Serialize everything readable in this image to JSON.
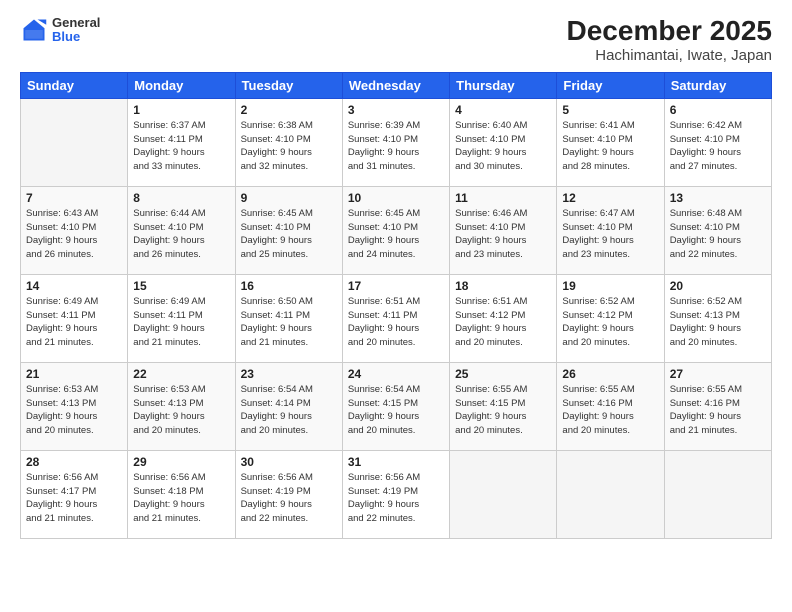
{
  "header": {
    "logo": {
      "general": "General",
      "blue": "Blue"
    },
    "title": "December 2025",
    "subtitle": "Hachimantai, Iwate, Japan"
  },
  "calendar": {
    "weekdays": [
      "Sunday",
      "Monday",
      "Tuesday",
      "Wednesday",
      "Thursday",
      "Friday",
      "Saturday"
    ],
    "weeks": [
      [
        {
          "day": "",
          "info": ""
        },
        {
          "day": "1",
          "info": "Sunrise: 6:37 AM\nSunset: 4:11 PM\nDaylight: 9 hours\nand 33 minutes."
        },
        {
          "day": "2",
          "info": "Sunrise: 6:38 AM\nSunset: 4:10 PM\nDaylight: 9 hours\nand 32 minutes."
        },
        {
          "day": "3",
          "info": "Sunrise: 6:39 AM\nSunset: 4:10 PM\nDaylight: 9 hours\nand 31 minutes."
        },
        {
          "day": "4",
          "info": "Sunrise: 6:40 AM\nSunset: 4:10 PM\nDaylight: 9 hours\nand 30 minutes."
        },
        {
          "day": "5",
          "info": "Sunrise: 6:41 AM\nSunset: 4:10 PM\nDaylight: 9 hours\nand 28 minutes."
        },
        {
          "day": "6",
          "info": "Sunrise: 6:42 AM\nSunset: 4:10 PM\nDaylight: 9 hours\nand 27 minutes."
        }
      ],
      [
        {
          "day": "7",
          "info": "Sunrise: 6:43 AM\nSunset: 4:10 PM\nDaylight: 9 hours\nand 26 minutes."
        },
        {
          "day": "8",
          "info": "Sunrise: 6:44 AM\nSunset: 4:10 PM\nDaylight: 9 hours\nand 26 minutes."
        },
        {
          "day": "9",
          "info": "Sunrise: 6:45 AM\nSunset: 4:10 PM\nDaylight: 9 hours\nand 25 minutes."
        },
        {
          "day": "10",
          "info": "Sunrise: 6:45 AM\nSunset: 4:10 PM\nDaylight: 9 hours\nand 24 minutes."
        },
        {
          "day": "11",
          "info": "Sunrise: 6:46 AM\nSunset: 4:10 PM\nDaylight: 9 hours\nand 23 minutes."
        },
        {
          "day": "12",
          "info": "Sunrise: 6:47 AM\nSunset: 4:10 PM\nDaylight: 9 hours\nand 23 minutes."
        },
        {
          "day": "13",
          "info": "Sunrise: 6:48 AM\nSunset: 4:10 PM\nDaylight: 9 hours\nand 22 minutes."
        }
      ],
      [
        {
          "day": "14",
          "info": "Sunrise: 6:49 AM\nSunset: 4:11 PM\nDaylight: 9 hours\nand 21 minutes."
        },
        {
          "day": "15",
          "info": "Sunrise: 6:49 AM\nSunset: 4:11 PM\nDaylight: 9 hours\nand 21 minutes."
        },
        {
          "day": "16",
          "info": "Sunrise: 6:50 AM\nSunset: 4:11 PM\nDaylight: 9 hours\nand 21 minutes."
        },
        {
          "day": "17",
          "info": "Sunrise: 6:51 AM\nSunset: 4:11 PM\nDaylight: 9 hours\nand 20 minutes."
        },
        {
          "day": "18",
          "info": "Sunrise: 6:51 AM\nSunset: 4:12 PM\nDaylight: 9 hours\nand 20 minutes."
        },
        {
          "day": "19",
          "info": "Sunrise: 6:52 AM\nSunset: 4:12 PM\nDaylight: 9 hours\nand 20 minutes."
        },
        {
          "day": "20",
          "info": "Sunrise: 6:52 AM\nSunset: 4:13 PM\nDaylight: 9 hours\nand 20 minutes."
        }
      ],
      [
        {
          "day": "21",
          "info": "Sunrise: 6:53 AM\nSunset: 4:13 PM\nDaylight: 9 hours\nand 20 minutes."
        },
        {
          "day": "22",
          "info": "Sunrise: 6:53 AM\nSunset: 4:13 PM\nDaylight: 9 hours\nand 20 minutes."
        },
        {
          "day": "23",
          "info": "Sunrise: 6:54 AM\nSunset: 4:14 PM\nDaylight: 9 hours\nand 20 minutes."
        },
        {
          "day": "24",
          "info": "Sunrise: 6:54 AM\nSunset: 4:15 PM\nDaylight: 9 hours\nand 20 minutes."
        },
        {
          "day": "25",
          "info": "Sunrise: 6:55 AM\nSunset: 4:15 PM\nDaylight: 9 hours\nand 20 minutes."
        },
        {
          "day": "26",
          "info": "Sunrise: 6:55 AM\nSunset: 4:16 PM\nDaylight: 9 hours\nand 20 minutes."
        },
        {
          "day": "27",
          "info": "Sunrise: 6:55 AM\nSunset: 4:16 PM\nDaylight: 9 hours\nand 21 minutes."
        }
      ],
      [
        {
          "day": "28",
          "info": "Sunrise: 6:56 AM\nSunset: 4:17 PM\nDaylight: 9 hours\nand 21 minutes."
        },
        {
          "day": "29",
          "info": "Sunrise: 6:56 AM\nSunset: 4:18 PM\nDaylight: 9 hours\nand 21 minutes."
        },
        {
          "day": "30",
          "info": "Sunrise: 6:56 AM\nSunset: 4:19 PM\nDaylight: 9 hours\nand 22 minutes."
        },
        {
          "day": "31",
          "info": "Sunrise: 6:56 AM\nSunset: 4:19 PM\nDaylight: 9 hours\nand 22 minutes."
        },
        {
          "day": "",
          "info": ""
        },
        {
          "day": "",
          "info": ""
        },
        {
          "day": "",
          "info": ""
        }
      ]
    ]
  }
}
